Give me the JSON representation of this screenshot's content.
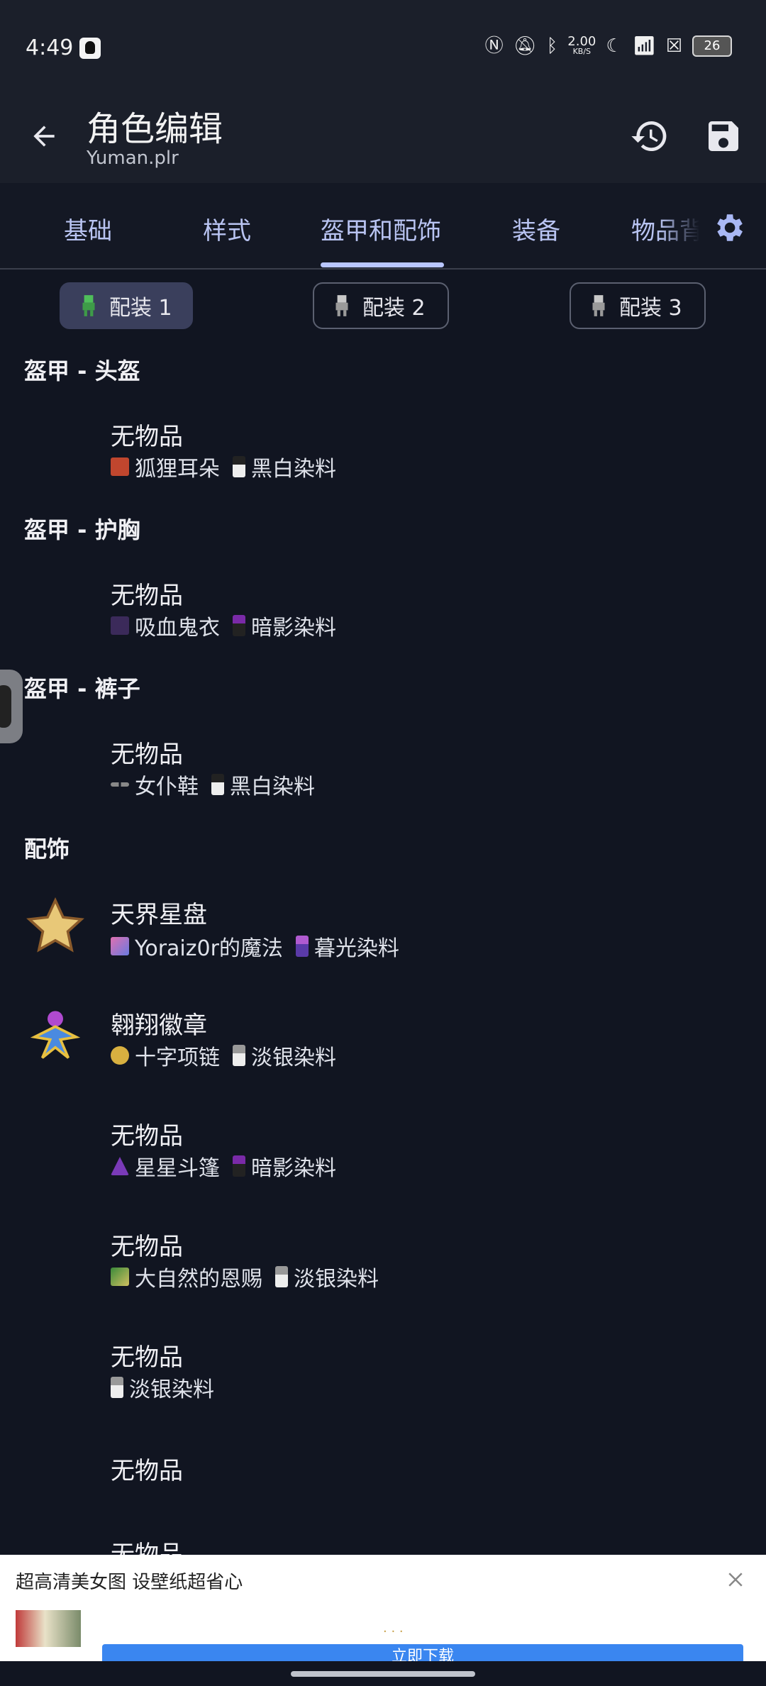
{
  "status": {
    "time": "4:49",
    "net_speed_value": "2.00",
    "net_speed_unit": "KB/S",
    "battery": "26"
  },
  "appbar": {
    "title": "角色编辑",
    "subtitle": "Yuman.plr"
  },
  "tabs": [
    "基础",
    "样式",
    "盔甲和配饰",
    "装备",
    "物品背"
  ],
  "loadouts": [
    "配装 1",
    "配装 2",
    "配装 3"
  ],
  "sections": {
    "helmet": "盔甲 - 头盔",
    "chest": "盔甲 - 护胸",
    "legs": "盔甲 - 裤子",
    "accessories": "配饰"
  },
  "items": [
    {
      "name": "无物品",
      "vanity": "狐狸耳朵",
      "dye": "黑白染料"
    },
    {
      "name": "无物品",
      "vanity": "吸血鬼衣",
      "dye": "暗影染料"
    },
    {
      "name": "无物品",
      "vanity": "女仆鞋",
      "dye": "黑白染料"
    },
    {
      "name": "天界星盘",
      "vanity": "Yoraiz0r的魔法",
      "dye": "暮光染料"
    },
    {
      "name": "翱翔徽章",
      "vanity": "十字项链",
      "dye": "淡银染料"
    },
    {
      "name": "无物品",
      "vanity": "星星斗篷",
      "dye": "暗影染料"
    },
    {
      "name": "无物品",
      "vanity": "大自然的恩赐",
      "dye": "淡银染料"
    },
    {
      "name": "无物品",
      "vanity": "",
      "dye": "淡银染料"
    },
    {
      "name": "无物品"
    },
    {
      "name": "无物品"
    }
  ],
  "ad": {
    "text": "超高清美女图 设壁纸超省心",
    "button": "立即下载"
  },
  "colors": {
    "background": "#111521",
    "appbar": "#1b1f2a",
    "accent": "#b9c6ff",
    "selected_chip": "#3a3f5c"
  }
}
